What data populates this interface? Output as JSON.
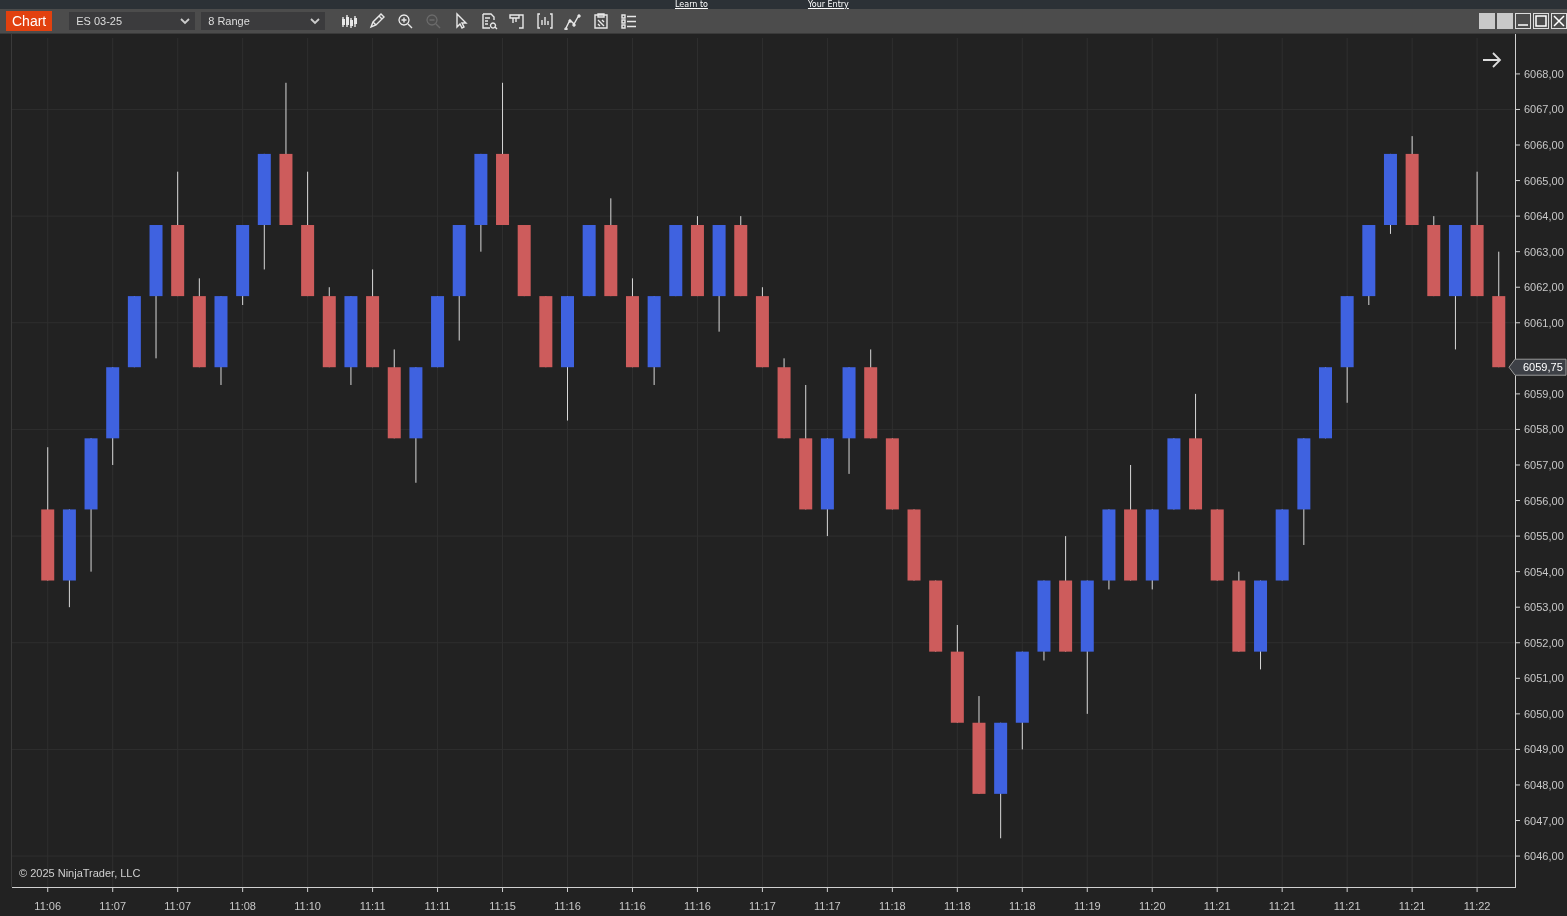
{
  "top_links": [
    "Learn to",
    "Your Entry"
  ],
  "toolbar": {
    "title": "Chart",
    "instrument": "ES 03-25",
    "bar_type": "8 Range",
    "tools": [
      {
        "kind": "bars",
        "disabled": false
      },
      {
        "kind": "pencil",
        "disabled": false
      },
      {
        "kind": "zoom_in",
        "disabled": false
      },
      {
        "kind": "zoom_out",
        "disabled": true
      },
      {
        "kind": "cursor",
        "disabled": false
      },
      {
        "kind": "doc_search",
        "disabled": false
      },
      {
        "kind": "panel",
        "disabled": false
      },
      {
        "kind": "chart_frame",
        "disabled": false
      },
      {
        "kind": "line_chart",
        "disabled": false
      },
      {
        "kind": "clipboard",
        "disabled": false
      },
      {
        "kind": "list",
        "disabled": false
      }
    ]
  },
  "chart": {
    "copyright": "© 2025 NinjaTrader, LLC",
    "last_price": "6059,75",
    "chart_data": {
      "type": "candlestick",
      "grid": true,
      "categories": [
        "11:06",
        null,
        null,
        "11:07",
        null,
        null,
        "11:07",
        null,
        null,
        "11:08",
        null,
        null,
        "11:10",
        null,
        null,
        "11:11",
        null,
        null,
        "11:11",
        null,
        null,
        "11:15",
        null,
        null,
        "11:16",
        null,
        null,
        "11:16",
        null,
        null,
        "11:16",
        null,
        null,
        "11:17",
        null,
        null,
        "11:17",
        null,
        null,
        "11:18",
        null,
        null,
        "11:18",
        null,
        null,
        "11:18",
        null,
        null,
        "11:19",
        null,
        null,
        "11:20",
        null,
        null,
        "11:21",
        null,
        null,
        "11:21",
        null,
        null,
        "11:21",
        null,
        null,
        "11:21",
        null,
        null,
        "11:22",
        null
      ],
      "ohlc": [
        [
          6055.75,
          6057.5,
          6053.75,
          6053.75
        ],
        [
          6053.75,
          6055.75,
          6053.0,
          6055.75
        ],
        [
          6055.75,
          6057.75,
          6054.0,
          6057.75
        ],
        [
          6057.75,
          6059.75,
          6057.0,
          6059.75
        ],
        [
          6059.75,
          6061.75,
          6059.75,
          6061.75
        ],
        [
          6061.75,
          6063.75,
          6060.0,
          6063.75
        ],
        [
          6063.75,
          6065.25,
          6061.75,
          6061.75
        ],
        [
          6061.75,
          6062.25,
          6059.75,
          6059.75
        ],
        [
          6059.75,
          6061.75,
          6059.25,
          6061.75
        ],
        [
          6061.75,
          6063.75,
          6061.5,
          6063.75
        ],
        [
          6063.75,
          6065.75,
          6062.5,
          6065.75
        ],
        [
          6065.75,
          6067.75,
          6063.75,
          6063.75
        ],
        [
          6063.75,
          6065.25,
          6061.75,
          6061.75
        ],
        [
          6061.75,
          6062.0,
          6059.75,
          6059.75
        ],
        [
          6059.75,
          6061.75,
          6059.25,
          6061.75
        ],
        [
          6061.75,
          6062.5,
          6059.75,
          6059.75
        ],
        [
          6059.75,
          6060.25,
          6057.75,
          6057.75
        ],
        [
          6057.75,
          6059.75,
          6056.5,
          6059.75
        ],
        [
          6059.75,
          6061.75,
          6059.75,
          6061.75
        ],
        [
          6061.75,
          6063.75,
          6060.5,
          6063.75
        ],
        [
          6063.75,
          6065.75,
          6063.0,
          6065.75
        ],
        [
          6065.75,
          6067.75,
          6063.75,
          6063.75
        ],
        [
          6063.75,
          6063.75,
          6061.75,
          6061.75
        ],
        [
          6061.75,
          6061.75,
          6059.75,
          6059.75
        ],
        [
          6059.75,
          6061.75,
          6058.25,
          6061.75
        ],
        [
          6061.75,
          6063.75,
          6061.75,
          6063.75
        ],
        [
          6063.75,
          6064.5,
          6061.75,
          6061.75
        ],
        [
          6061.75,
          6062.25,
          6059.75,
          6059.75
        ],
        [
          6059.75,
          6061.75,
          6059.25,
          6061.75
        ],
        [
          6061.75,
          6063.75,
          6061.75,
          6063.75
        ],
        [
          6063.75,
          6064.0,
          6061.75,
          6061.75
        ],
        [
          6061.75,
          6063.75,
          6060.75,
          6063.75
        ],
        [
          6063.75,
          6064.0,
          6061.75,
          6061.75
        ],
        [
          6061.75,
          6062.0,
          6059.75,
          6059.75
        ],
        [
          6059.75,
          6060.0,
          6057.75,
          6057.75
        ],
        [
          6057.75,
          6059.25,
          6055.75,
          6055.75
        ],
        [
          6055.75,
          6057.75,
          6055.0,
          6057.75
        ],
        [
          6057.75,
          6059.75,
          6056.75,
          6059.75
        ],
        [
          6059.75,
          6060.25,
          6057.75,
          6057.75
        ],
        [
          6057.75,
          6057.75,
          6055.75,
          6055.75
        ],
        [
          6055.75,
          6055.75,
          6053.75,
          6053.75
        ],
        [
          6053.75,
          6053.75,
          6051.75,
          6051.75
        ],
        [
          6051.75,
          6052.5,
          6049.75,
          6049.75
        ],
        [
          6049.75,
          6050.5,
          6047.75,
          6047.75
        ],
        [
          6047.75,
          6049.75,
          6046.5,
          6049.75
        ],
        [
          6049.75,
          6051.75,
          6049.0,
          6051.75
        ],
        [
          6051.75,
          6053.75,
          6051.5,
          6053.75
        ],
        [
          6053.75,
          6055.0,
          6051.75,
          6051.75
        ],
        [
          6051.75,
          6053.75,
          6050.0,
          6053.75
        ],
        [
          6053.75,
          6055.75,
          6053.5,
          6055.75
        ],
        [
          6055.75,
          6057.0,
          6053.75,
          6053.75
        ],
        [
          6053.75,
          6055.75,
          6053.5,
          6055.75
        ],
        [
          6055.75,
          6057.75,
          6055.75,
          6057.75
        ],
        [
          6057.75,
          6059.0,
          6055.75,
          6055.75
        ],
        [
          6055.75,
          6055.75,
          6053.75,
          6053.75
        ],
        [
          6053.75,
          6054.0,
          6051.75,
          6051.75
        ],
        [
          6051.75,
          6053.75,
          6051.25,
          6053.75
        ],
        [
          6053.75,
          6055.75,
          6053.75,
          6055.75
        ],
        [
          6055.75,
          6057.75,
          6054.75,
          6057.75
        ],
        [
          6057.75,
          6059.75,
          6057.75,
          6059.75
        ],
        [
          6059.75,
          6061.75,
          6058.75,
          6061.75
        ],
        [
          6061.75,
          6063.75,
          6061.5,
          6063.75
        ],
        [
          6063.75,
          6065.75,
          6063.5,
          6065.75
        ],
        [
          6065.75,
          6066.25,
          6063.75,
          6063.75
        ],
        [
          6063.75,
          6064.0,
          6061.75,
          6061.75
        ],
        [
          6061.75,
          6063.75,
          6060.25,
          6063.75
        ],
        [
          6063.75,
          6065.25,
          6061.75,
          6061.75
        ],
        [
          6061.75,
          6063.0,
          6059.75,
          6059.75
        ]
      ],
      "ylim": [
        6045.13,
        6069.01
      ],
      "yticks": [
        {
          "value": 6046,
          "label": "6046,00"
        },
        {
          "value": 6047,
          "label": "6047,00"
        },
        {
          "value": 6048,
          "label": "6048,00"
        },
        {
          "value": 6049,
          "label": "6049,00"
        },
        {
          "value": 6050,
          "label": "6050,00"
        },
        {
          "value": 6051,
          "label": "6051,00"
        },
        {
          "value": 6052,
          "label": "6052,00"
        },
        {
          "value": 6053,
          "label": "6053,00"
        },
        {
          "value": 6054,
          "label": "6054,00"
        },
        {
          "value": 6055,
          "label": "6055,00"
        },
        {
          "value": 6056,
          "label": "6056,00"
        },
        {
          "value": 6057,
          "label": "6057,00"
        },
        {
          "value": 6058,
          "label": "6058,00"
        },
        {
          "value": 6059,
          "label": "6059,00"
        },
        {
          "value": 6061,
          "label": "6061,00"
        },
        {
          "value": 6062,
          "label": "6062,00"
        },
        {
          "value": 6063,
          "label": "6063,00"
        },
        {
          "value": 6064,
          "label": "6064,00"
        },
        {
          "value": 6065,
          "label": "6065,00"
        },
        {
          "value": 6066,
          "label": "6066,00"
        },
        {
          "value": 6067,
          "label": "6067,00"
        },
        {
          "value": 6068,
          "label": "6068,00"
        }
      ]
    }
  }
}
